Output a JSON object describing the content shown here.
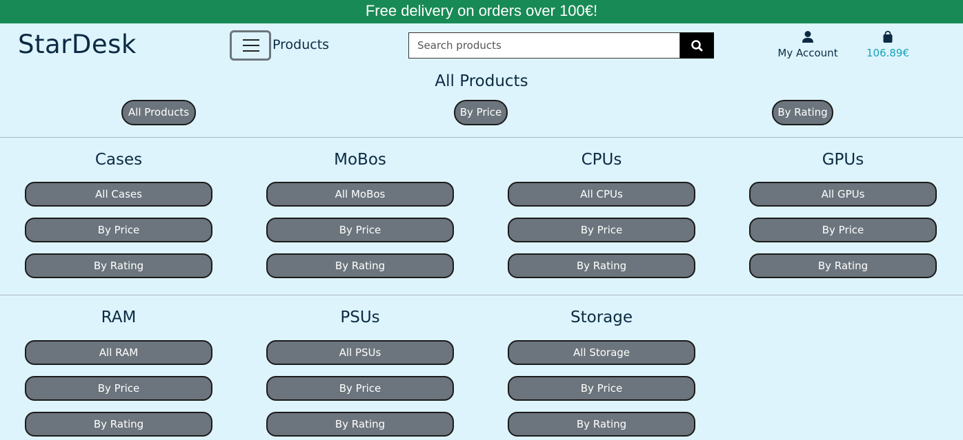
{
  "banner": {
    "text": "Free delivery on orders over 100€!"
  },
  "header": {
    "logo": "StarDesk",
    "menu_label": "Products",
    "search_placeholder": "Search products",
    "account_label": "My Account",
    "bag_total": "106.89€"
  },
  "all_products": {
    "title": "All Products",
    "buttons": [
      "All Products",
      "By Price",
      "By Rating"
    ]
  },
  "categories": [
    {
      "title": "Cases",
      "buttons": [
        "All Cases",
        "By Price",
        "By Rating"
      ]
    },
    {
      "title": "MoBos",
      "buttons": [
        "All MoBos",
        "By Price",
        "By Rating"
      ]
    },
    {
      "title": "CPUs",
      "buttons": [
        "All CPUs",
        "By Price",
        "By Rating"
      ]
    },
    {
      "title": "GPUs",
      "buttons": [
        "All GPUs",
        "By Price",
        "By Rating"
      ]
    },
    {
      "title": "RAM",
      "buttons": [
        "All RAM",
        "By Price",
        "By Rating"
      ]
    },
    {
      "title": "PSUs",
      "buttons": [
        "All PSUs",
        "By Price",
        "By Rating"
      ]
    },
    {
      "title": "Storage",
      "buttons": [
        "All Storage",
        "By Price",
        "By Rating"
      ]
    }
  ],
  "colors": {
    "banner": "#188a55",
    "background": "#ddf4fd",
    "button": "#6c757d",
    "bag_total": "#17a2b8",
    "text": "#0c2a42"
  },
  "icons": {
    "menu": "hamburger-icon",
    "search": "search-icon",
    "account": "user-icon",
    "bag": "shopping-bag-icon"
  }
}
